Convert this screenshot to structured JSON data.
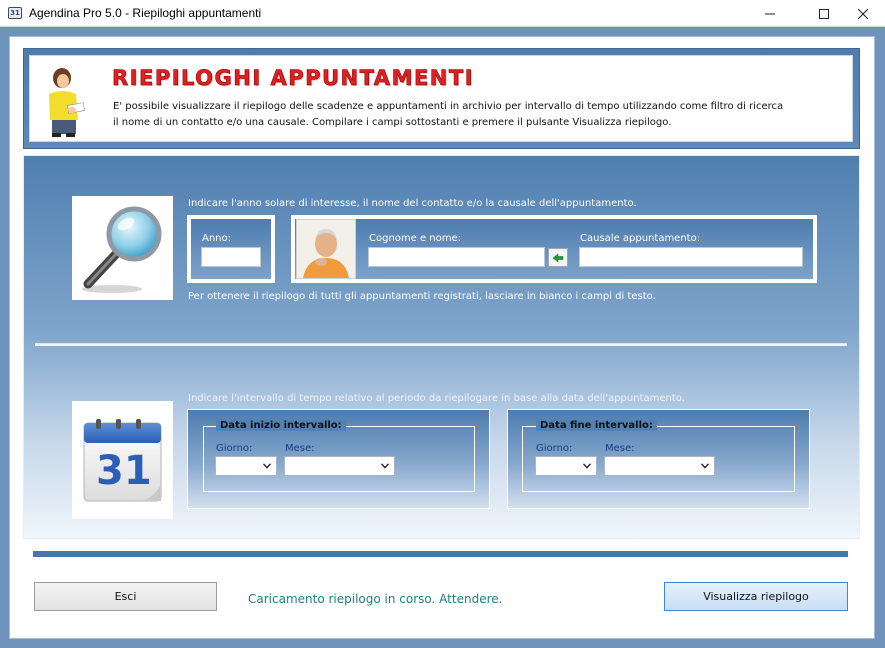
{
  "window": {
    "app_icon": "calendar-app-icon",
    "title": "Agendina Pro 5.0 - Riepiloghi appuntamenti"
  },
  "header": {
    "title": "RIEPILOGHI APPUNTAMENTI",
    "desc_line1": "E' possibile visualizzare il riepilogo delle scadenze e appuntamenti in archivio per intervallo di tempo utilizzando come filtro di ricerca",
    "desc_line2": "il nome di un contatto e/o una causale. Compilare i campi sottostanti e premere il pulsante Visualizza riepilogo."
  },
  "filters": {
    "instruction": "Indicare l'anno solare di interesse, il nome del contatto e/o la causale dell'appuntamento.",
    "anno_label": "Anno:",
    "anno_value": "",
    "nome_label": "Cognome e nome:",
    "nome_value": "",
    "causale_label": "Causale appuntamento:",
    "causale_value": "",
    "note": "Per ottenere il riepilogo di tutti gli appuntamenti registrati, lasciare in bianco i campi di testo."
  },
  "interval": {
    "instruction": "Indicare l'intervallo di tempo relativo al periodo da riepilogare in base alla data dell'appuntamento.",
    "start": {
      "legend": "Data inizio intervallo:",
      "giorno_label": "Giorno:",
      "giorno_value": "",
      "mese_label": "Mese:",
      "mese_value": ""
    },
    "end": {
      "legend": "Data fine intervallo:",
      "giorno_label": "Giorno:",
      "giorno_value": "",
      "mese_label": "Mese:",
      "mese_value": ""
    }
  },
  "calendar_day": "31",
  "footer": {
    "esci_label": "Esci",
    "status": "Caricamento riepilogo in corso. Attendere.",
    "visualizza_label": "Visualizza riepilogo"
  },
  "colors": {
    "title_red": "#e02020",
    "panel_blue": "#4f7fb0",
    "status_teal": "#22807b",
    "primary_button_border": "#3f86d4"
  }
}
